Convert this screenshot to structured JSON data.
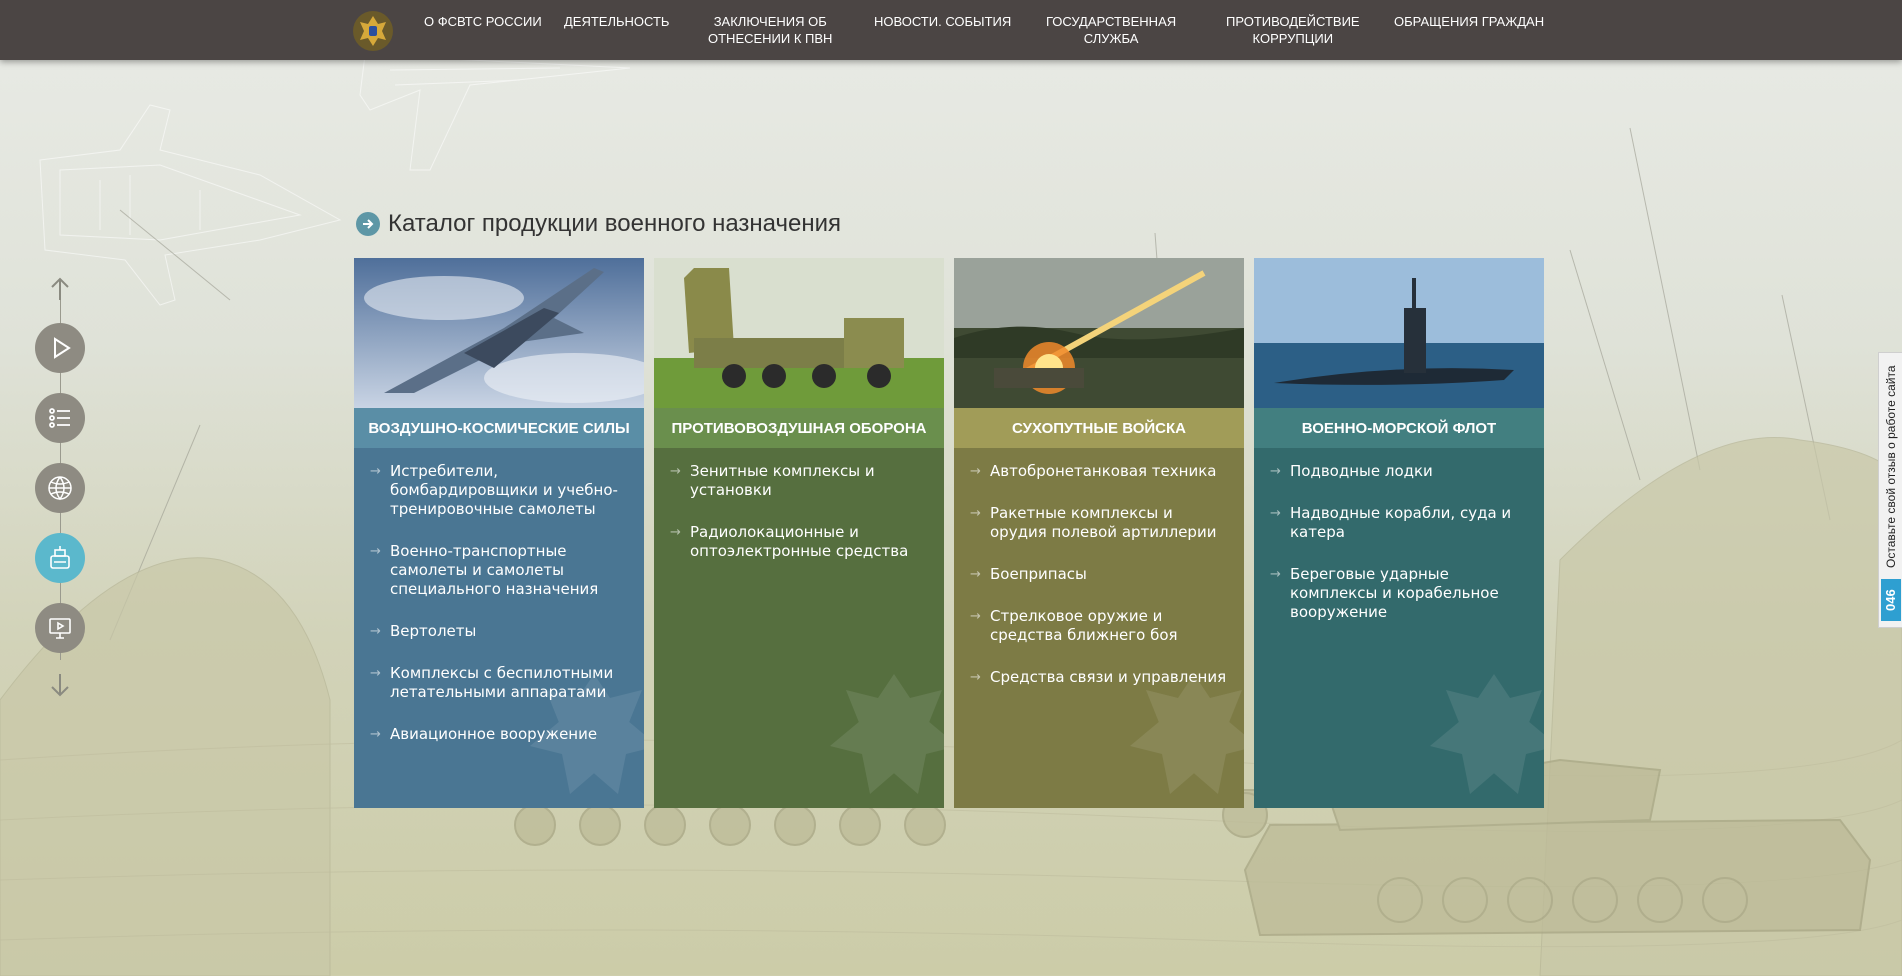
{
  "nav": {
    "items": [
      {
        "label": "О ФСВТС России"
      },
      {
        "label": "Деятельность"
      },
      {
        "label": "Заключения об\nотнесении к ПВН"
      },
      {
        "label": "Новости. События"
      },
      {
        "label": "Государственная\nслужба"
      },
      {
        "label": "Противодействие\nкоррупции"
      },
      {
        "label": "Обращения граждан"
      }
    ]
  },
  "rail": {
    "buttons": [
      {
        "icon": "play-icon",
        "active": false
      },
      {
        "icon": "list-icon",
        "active": false
      },
      {
        "icon": "globe-icon",
        "active": false
      },
      {
        "icon": "tank-icon",
        "active": true
      },
      {
        "icon": "monitor-icon",
        "active": false
      }
    ]
  },
  "page": {
    "heading": "Каталог продукции военного назначения"
  },
  "cards": [
    {
      "title": "Воздушно-космические силы",
      "color": "#4a7693",
      "title_color": "#5a8ea6",
      "image": "fighter-jet-image",
      "items": [
        "Истребители, бомбардировщики и учебно-тренировочные самолеты",
        "Военно-транспортные самолеты и самолеты специального назначения",
        "Вертолеты",
        "Комплексы с беспилотными летательными аппаратами",
        "Авиационное вооружение"
      ]
    },
    {
      "title": "Противовоздушная оборона",
      "color": "#566f3f",
      "title_color": "#6a8f4d",
      "image": "air-defense-truck-image",
      "items": [
        "Зенитные комплексы и установки",
        "Радиолокационные и оптоэлектронные средства"
      ]
    },
    {
      "title": "Сухопутные войска",
      "color": "#7d7b45",
      "title_color": "#a19c58",
      "image": "rocket-launch-image",
      "items": [
        "Автобронетанковая техника",
        "Ракетные комплексы и орудия полевой артиллерии",
        "Боеприпасы",
        "Стрелковое оружие и средства ближнего боя",
        "Средства связи и управления"
      ]
    },
    {
      "title": "Военно-морской флот",
      "color": "#336a6c",
      "title_color": "#427f80",
      "image": "submarine-image",
      "items": [
        "Подводные лодки",
        "Надводные корабли, суда и катера",
        "Береговые ударные комплексы и корабельное вооружение"
      ]
    }
  ],
  "feedback": {
    "text": "Оставьте свой отзыв о работе сайта",
    "badge": "046"
  }
}
